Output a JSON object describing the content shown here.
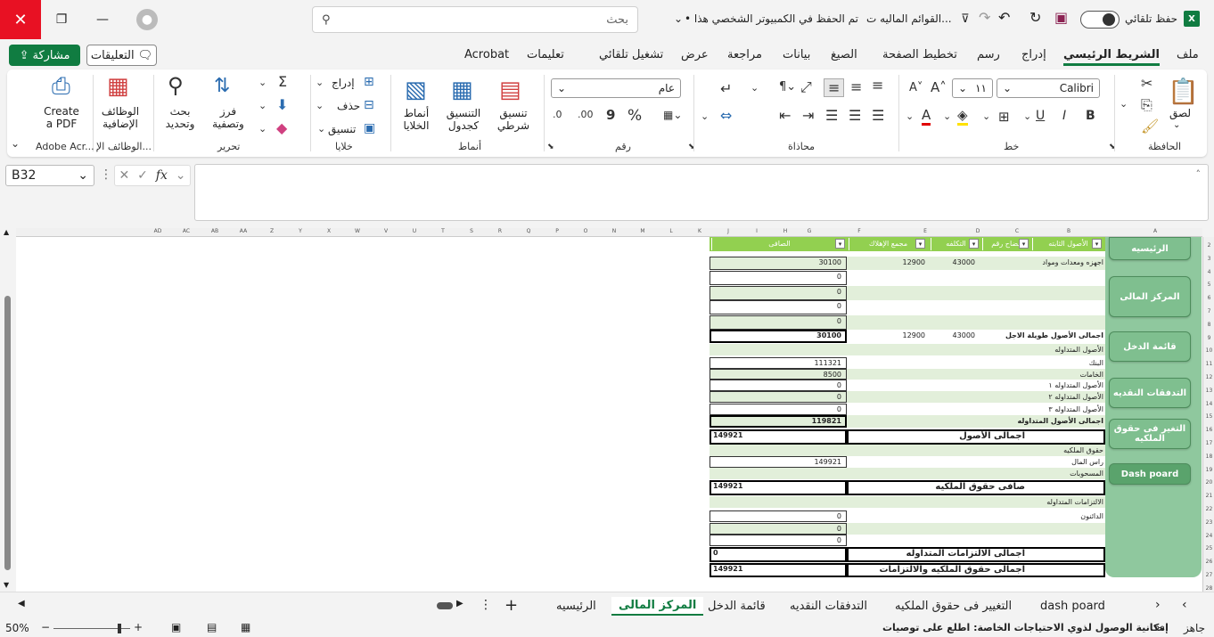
{
  "titlebar": {
    "search_placeholder": "بحث",
    "doc_title": "القوائم الماليه ت...",
    "save_status": "• تم الحفظ في الكمبيوتر الشخصي هذا",
    "autosave_label": "حفظ تلقائي"
  },
  "tabs": [
    "ملف",
    "الشريط الرئيسي",
    "إدراج",
    "رسم",
    "تخطيط الصفحة",
    "الصيغ",
    "بيانات",
    "مراجعة",
    "عرض",
    "تشغيل تلقائي",
    "تعليمات",
    "Acrobat"
  ],
  "share_label": "مشاركة",
  "comments_label": "التعليقات",
  "ribbon": {
    "clipboard": {
      "paste": "لصق",
      "label": "الحافظة"
    },
    "font": {
      "name": "Calibri",
      "size": "١١",
      "label": "خط",
      "bold": "B",
      "italic": "I",
      "underline": "U"
    },
    "alignment": {
      "label": "محاذاة"
    },
    "number": {
      "format": "عام",
      "label": "رقم",
      "percent": "%",
      "comma": "9"
    },
    "styles": {
      "conditional": "تنسيق شرطي",
      "table": "التنسيق كجدول",
      "cell": "أنماط الخلايا",
      "label": "أنماط"
    },
    "cells": {
      "insert": "إدراج",
      "delete": "حذف",
      "format": "تنسيق",
      "label": "خلايا"
    },
    "editing": {
      "sort": "فرز وتصفية",
      "find": "بحث وتحديد",
      "label": "تحرير"
    },
    "addins": {
      "btn": "الوظائف الإضافية",
      "label": "الوظائف الإ..."
    },
    "acrobat": {
      "btn": "Create a PDF",
      "label": "Adobe Acr..."
    }
  },
  "formula": {
    "namebox": "B32",
    "fx": "fx"
  },
  "columns": [
    "A",
    "B",
    "C",
    "D",
    "E",
    "F",
    "G",
    "H",
    "I",
    "J",
    "K",
    "L",
    "M",
    "N",
    "O",
    "P",
    "Q",
    "R",
    "S",
    "T",
    "U",
    "V",
    "W",
    "X",
    "Y",
    "Z",
    "AA",
    "AB",
    "AC",
    "AD"
  ],
  "rows": [
    "2",
    "3",
    "4",
    "5",
    "6",
    "7",
    "8",
    "9",
    "10",
    "11",
    "12",
    "13",
    "14",
    "15",
    "16",
    "17",
    "18",
    "19",
    "20",
    "21",
    "22",
    "23",
    "24",
    "25",
    "26",
    "27",
    "28"
  ],
  "table": {
    "header": {
      "fixed_assets": "الأصول الثابته",
      "note": "إيضاح رقم",
      "cost": "التكلفه",
      "depreciation": "مجمع الإهلاك",
      "net": "الصافى"
    },
    "rows": [
      {
        "label": "اجهزه ومعدات ومواد",
        "cost": "43000",
        "dep": "12900",
        "net": "30100"
      },
      {
        "label": "",
        "net": "0"
      },
      {
        "label": "",
        "net": "0"
      },
      {
        "label": "",
        "net": "0"
      },
      {
        "label": "",
        "net": "0"
      },
      {
        "label": "اجمالى الأصول طويلة الاجل",
        "cost": "43000",
        "dep": "12900",
        "net": "30100"
      },
      {
        "label": "الأصول المتداوله"
      },
      {
        "label": "البنك",
        "net": "111321"
      },
      {
        "label": "الخامات",
        "net": "8500"
      },
      {
        "label": "الأصول المتداوله ١",
        "net": "0"
      },
      {
        "label": "الأصول المتداوله ٢",
        "net": "0"
      },
      {
        "label": "الأصول المتداوله ٣",
        "net": "0"
      },
      {
        "label": "اجمالى الأصول المتداوله",
        "net": "119821"
      },
      {
        "label": "اجمالى الأصول",
        "net": "149921"
      },
      {
        "label": "حقوق الملكيه"
      },
      {
        "label": "راس المال",
        "net": "149921"
      },
      {
        "label": "المسحوبات"
      },
      {
        "label": "صافى حقوق الملكيه",
        "net": "149921"
      },
      {
        "label": "الالتزامات المتداوله"
      },
      {
        "label": "الدائنون",
        "net": "0"
      },
      {
        "label": "",
        "net": "0"
      },
      {
        "label": "",
        "net": "0"
      },
      {
        "label": "اجمالى الالتزامات المتداوله",
        "net": "0"
      },
      {
        "label": "اجمالى حقوق الملكيه والالتزامات",
        "net": "149921"
      }
    ]
  },
  "nav_buttons": [
    "الرئيسيه",
    "المركز المالى",
    "قائمة الدخل",
    "التدفقات النقديه",
    "التغير فى حقوق الملكيه",
    "Dash poard"
  ],
  "sheet_tabs": [
    "dash poard",
    "التغيير فى حقوق الملكيه",
    "التدفقات النقديه",
    "قائمة الدخل",
    "المركز المالى",
    "الرئيسيه"
  ],
  "status": {
    "ready": "جاهز",
    "accessibility": "إمكانية الوصول لذوي الاحتياجات الخاصة: اطلع على توصيات",
    "zoom": "50%"
  },
  "colors": {
    "accent": "#107c41",
    "nav_bg": "#8fc89e",
    "table_green": "#e2efda",
    "header_green": "#92d050"
  }
}
